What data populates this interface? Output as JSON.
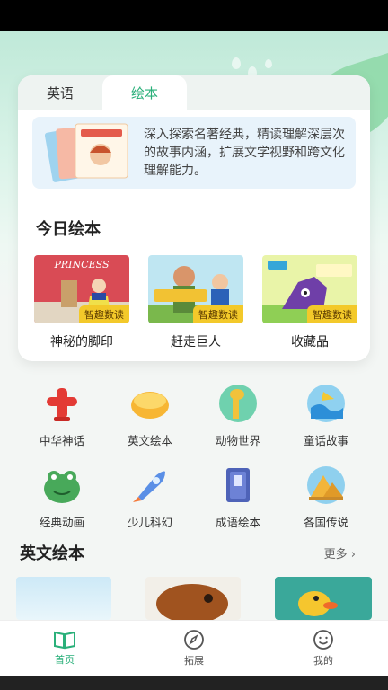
{
  "tabs": [
    "英语",
    "绘本"
  ],
  "active_tab": 1,
  "intro": "深入探索名著经典，精读理解深层次的故事内涵，扩展文学视野和跨文化理解能力。",
  "today": {
    "title": "今日绘本",
    "books": [
      {
        "title": "神秘的脚印",
        "badge": "智趣数读"
      },
      {
        "title": "赶走巨人",
        "badge": "智趣数读"
      },
      {
        "title": "收藏品",
        "badge": "智趣数读"
      }
    ]
  },
  "categories": [
    "中华神话",
    "英文绘本",
    "动物世界",
    "童话故事",
    "经典动画",
    "少儿科幻",
    "成语绘本",
    "各国传说"
  ],
  "english": {
    "title": "英文绘本",
    "more": "更多 ›"
  },
  "nav": [
    "首页",
    "拓展",
    "我的"
  ],
  "colors": {
    "accent": "#2ab07a",
    "badge": "#f3c92a"
  }
}
